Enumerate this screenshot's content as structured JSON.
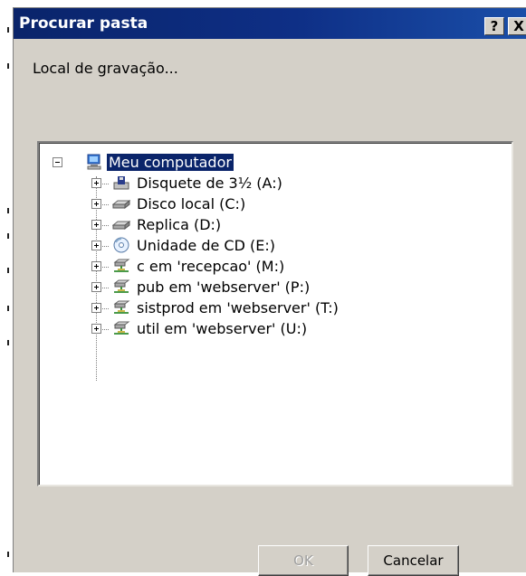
{
  "window": {
    "title": "Procurar pasta",
    "help_label": "?",
    "close_label": "X"
  },
  "instruction": "Local de gravação...",
  "tree": {
    "root": {
      "label": "Meu computador",
      "icon": "my-computer-icon",
      "selected": true
    },
    "items": [
      {
        "label": "Disquete de 3½ (A:)",
        "icon": "floppy-drive-icon"
      },
      {
        "label": "Disco local (C:)",
        "icon": "hard-disk-icon"
      },
      {
        "label": "Replica (D:)",
        "icon": "hard-disk-icon"
      },
      {
        "label": "Unidade de CD (E:)",
        "icon": "cd-drive-icon"
      },
      {
        "label": "c em 'recepcao' (M:)",
        "icon": "network-drive-icon"
      },
      {
        "label": "pub em 'webserver' (P:)",
        "icon": "network-drive-icon"
      },
      {
        "label": "sistprod em 'webserver' (T:)",
        "icon": "network-drive-icon"
      },
      {
        "label": "util em 'webserver' (U:)",
        "icon": "network-drive-icon"
      }
    ]
  },
  "buttons": {
    "ok": "OK",
    "cancel": "Cancelar"
  },
  "colors": {
    "titlebar": "#0a246a",
    "dialog_bg": "#d4d0c8",
    "selection": "#0a246a"
  }
}
